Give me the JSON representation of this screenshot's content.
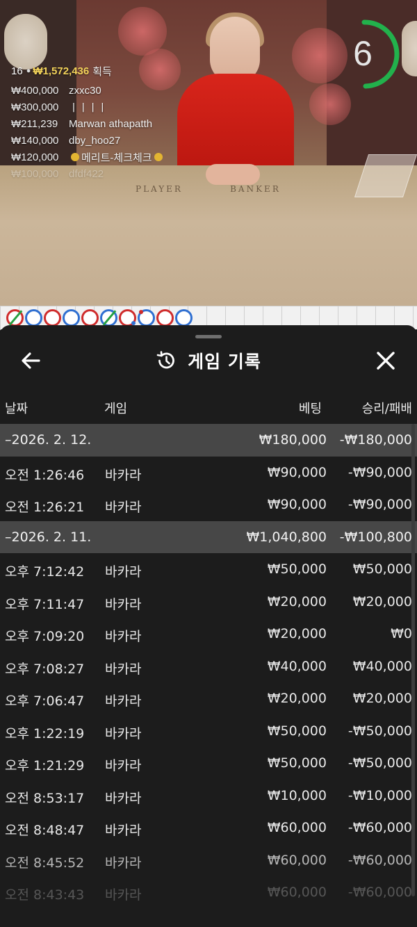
{
  "stream": {
    "timer_value": "6",
    "table_print_left": "PLAYER",
    "table_print_right": "BANKER",
    "winners_summary": {
      "count": "16",
      "amount": "₩1,572,436",
      "suffix": "획득"
    },
    "winners": [
      {
        "amount": "₩400,000",
        "name": "zxxc30"
      },
      {
        "amount": "₩300,000",
        "name": "ㅣㅣㅣㅣ"
      },
      {
        "amount": "₩211,239",
        "name": "Marwan athapatth"
      },
      {
        "amount": "₩140,000",
        "name": "dby_hoo27"
      },
      {
        "amount": "₩120,000",
        "name": "메리트-체크체크"
      },
      {
        "amount": "₩100,000",
        "name": "dfdf422"
      }
    ],
    "colors": {
      "timer_ring": "#22b14c",
      "winner_amount": "#f3d35a"
    }
  },
  "road": {
    "beads": [
      "player-slash",
      "banker",
      "player",
      "banker",
      "player",
      "banker-slash",
      "player-dot",
      "banker-dot",
      "player",
      "banker"
    ],
    "colors": {
      "banker": "#2f6fd1",
      "player": "#cf2b2b",
      "tie": "#26a040"
    }
  },
  "history": {
    "title": "게임 기록",
    "icons": {
      "back": "arrow-left-icon",
      "history": "history-clock-icon",
      "close": "close-icon"
    },
    "columns": {
      "date": "날짜",
      "game": "게임",
      "bet": "베팅",
      "result": "승리/패배"
    },
    "rows": [
      {
        "type": "group",
        "time": "–2026. 2. 12.",
        "game": "",
        "bet": "₩180,000",
        "result": "-₩180,000"
      },
      {
        "type": "item",
        "time": "오전 1:26:46",
        "game": "바카라",
        "bet": "₩90,000",
        "result": "-₩90,000"
      },
      {
        "type": "item",
        "time": "오전 1:26:21",
        "game": "바카라",
        "bet": "₩90,000",
        "result": "-₩90,000"
      },
      {
        "type": "group",
        "time": "–2026. 2. 11.",
        "game": "",
        "bet": "₩1,040,800",
        "result": "-₩100,800"
      },
      {
        "type": "item",
        "time": "오후 7:12:42",
        "game": "바카라",
        "bet": "₩50,000",
        "result": "₩50,000"
      },
      {
        "type": "item",
        "time": "오후 7:11:47",
        "game": "바카라",
        "bet": "₩20,000",
        "result": "₩20,000"
      },
      {
        "type": "item",
        "time": "오후 7:09:20",
        "game": "바카라",
        "bet": "₩20,000",
        "result": "₩0"
      },
      {
        "type": "item",
        "time": "오후 7:08:27",
        "game": "바카라",
        "bet": "₩40,000",
        "result": "₩40,000"
      },
      {
        "type": "item",
        "time": "오후 7:06:47",
        "game": "바카라",
        "bet": "₩20,000",
        "result": "₩20,000"
      },
      {
        "type": "item",
        "time": "오후 1:22:19",
        "game": "바카라",
        "bet": "₩50,000",
        "result": "-₩50,000"
      },
      {
        "type": "item",
        "time": "오후 1:21:29",
        "game": "바카라",
        "bet": "₩50,000",
        "result": "-₩50,000"
      },
      {
        "type": "item",
        "time": "오전 8:53:17",
        "game": "바카라",
        "bet": "₩10,000",
        "result": "-₩10,000"
      },
      {
        "type": "item",
        "time": "오전 8:48:47",
        "game": "바카라",
        "bet": "₩60,000",
        "result": "-₩60,000"
      },
      {
        "type": "item",
        "time": "오전 8:45:52",
        "game": "바카라",
        "bet": "₩60,000",
        "result": "-₩60,000"
      },
      {
        "type": "item",
        "time": "오전 8:43:43",
        "game": "바카라",
        "bet": "₩60,000",
        "result": "-₩60,000"
      }
    ]
  }
}
